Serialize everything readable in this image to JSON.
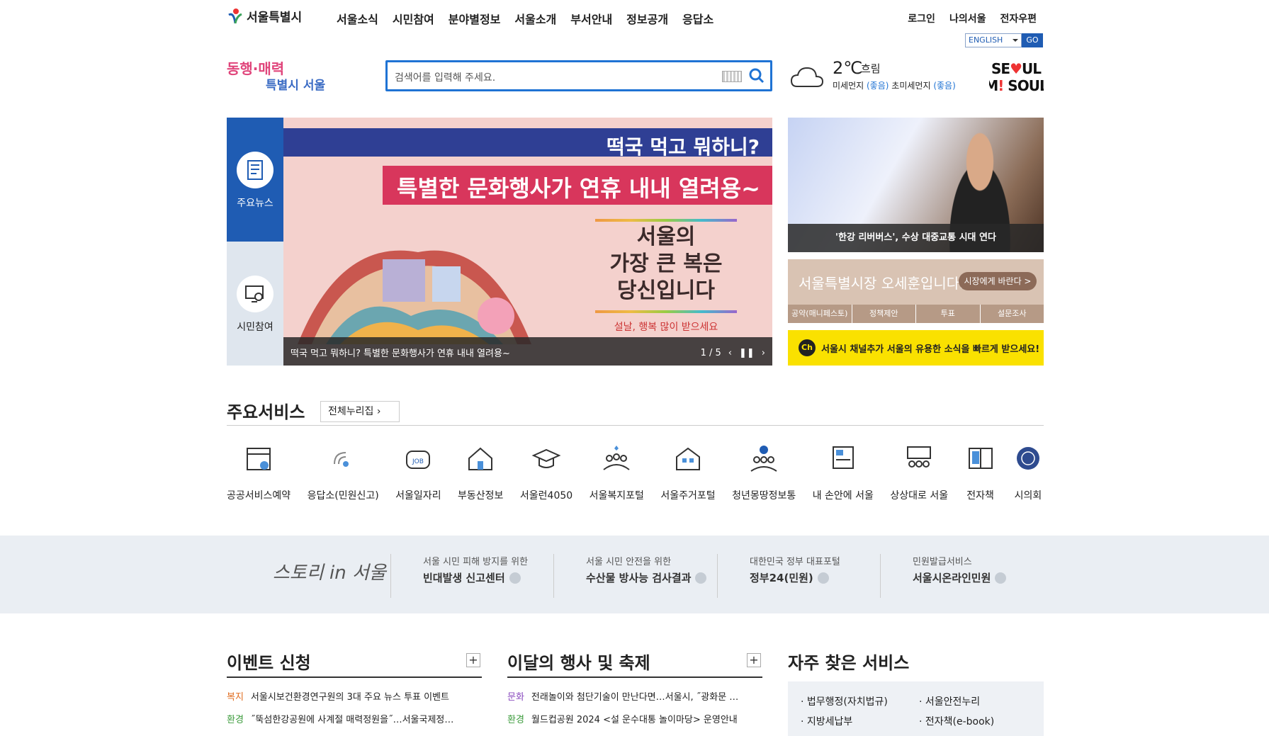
{
  "header": {
    "logo_text": "서울특별시",
    "gnb": [
      "서울소식",
      "시민참여",
      "분야별정보",
      "서울소개",
      "부서안내",
      "정보공개",
      "응답소"
    ],
    "util": [
      "로그인",
      "나의서울",
      "전자우편"
    ],
    "lang_select": "ENGLISH",
    "lang_go": "GO",
    "slogan": "동행·매력 특별시 서울",
    "search_placeholder": "검색어를 입력해 주세요.",
    "weather": {
      "temp": "2℃",
      "cond": "흐림",
      "dust_label": "미세먼지",
      "dust_val": "(좋음)",
      "ultra_label": "초미세먼지",
      "ultra_val": "(좋음)"
    },
    "brand": "SEOUL MY SOUL"
  },
  "visual": {
    "tabs": [
      "주요뉴스",
      "시민참여"
    ],
    "banner_top": "떡국 먹고 뭐하니?",
    "banner_pink": "특별한 문화행사가 연휴 내내 열려용~",
    "banner_big1": "서울의",
    "banner_big2": "가장 큰 복은",
    "banner_big3": "당신입니다",
    "banner_small": "설날, 행복 많이 받으세요",
    "caption": "떡국 먹고 뭐하니? 특별한 문화행사가 연휴 내내 열려용~",
    "page": "1 / 5"
  },
  "side": {
    "caption1": "'한강 리버버스', 수상 대중교통 시대 연다",
    "mayor_text": "서울특별시장 오세훈입니다.",
    "mayor_btn": "시장에게 바란다 >",
    "mayor_subs": [
      "공약(매니페스토)",
      "정책제안",
      "투표",
      "설문조사"
    ],
    "channel_ch": "Ch",
    "channel_text": "서울시 채널추가 서울의 유용한 소식을 빠르게 받으세요!"
  },
  "services": {
    "title": "주요서비스",
    "all_btn": "전체누리집",
    "items": [
      "공공서비스예약",
      "응답소(민원신고)",
      "서울일자리",
      "부동산정보",
      "서울런4050",
      "서울복지포털",
      "서울주거포털",
      "청년몽땅정보통",
      "내 손안에 서울",
      "상상대로 서울",
      "전자책",
      "시의회"
    ]
  },
  "band": {
    "story": "스토리 in 서울",
    "links": [
      {
        "sub": "서울 시민 피해 방지를 위한",
        "main": "빈대발생 신고센터"
      },
      {
        "sub": "서울 시민 안전을 위한",
        "main": "수산물 방사능 검사결과"
      },
      {
        "sub": "대한민국 정부 대표포털",
        "main": "정부24(민원)"
      },
      {
        "sub": "민원발급서비스",
        "main": "서울시온라인민원"
      }
    ]
  },
  "bottom": {
    "events_title": "이벤트 신청",
    "events": [
      {
        "cat": "복지",
        "color": "#e06c1f",
        "text": "서울시보건환경연구원의 3대 주요 뉴스 투표 이벤트"
      },
      {
        "cat": "환경",
        "color": "#3a9a3a",
        "text": "˝뚝섬한강공원에 사계절 매력정원을˝…서울국제정…"
      }
    ],
    "festival_title": "이달의 행사 및 축제",
    "festivals": [
      {
        "cat": "문화",
        "color": "#8a4bbf",
        "text": "전래놀이와 첨단기술이 만난다면…서울시, ˝광화문 …"
      },
      {
        "cat": "환경",
        "color": "#3a9a3a",
        "text": "월드컵공원 2024 <설 운수대통 놀이마당> 운영안내"
      }
    ],
    "faq_title": "자주 찾은 서비스",
    "faq": [
      "· 법무행정(자치법규)",
      "· 서울안전누리",
      "· 지방세납부",
      "· 전자책(e-book)"
    ]
  }
}
